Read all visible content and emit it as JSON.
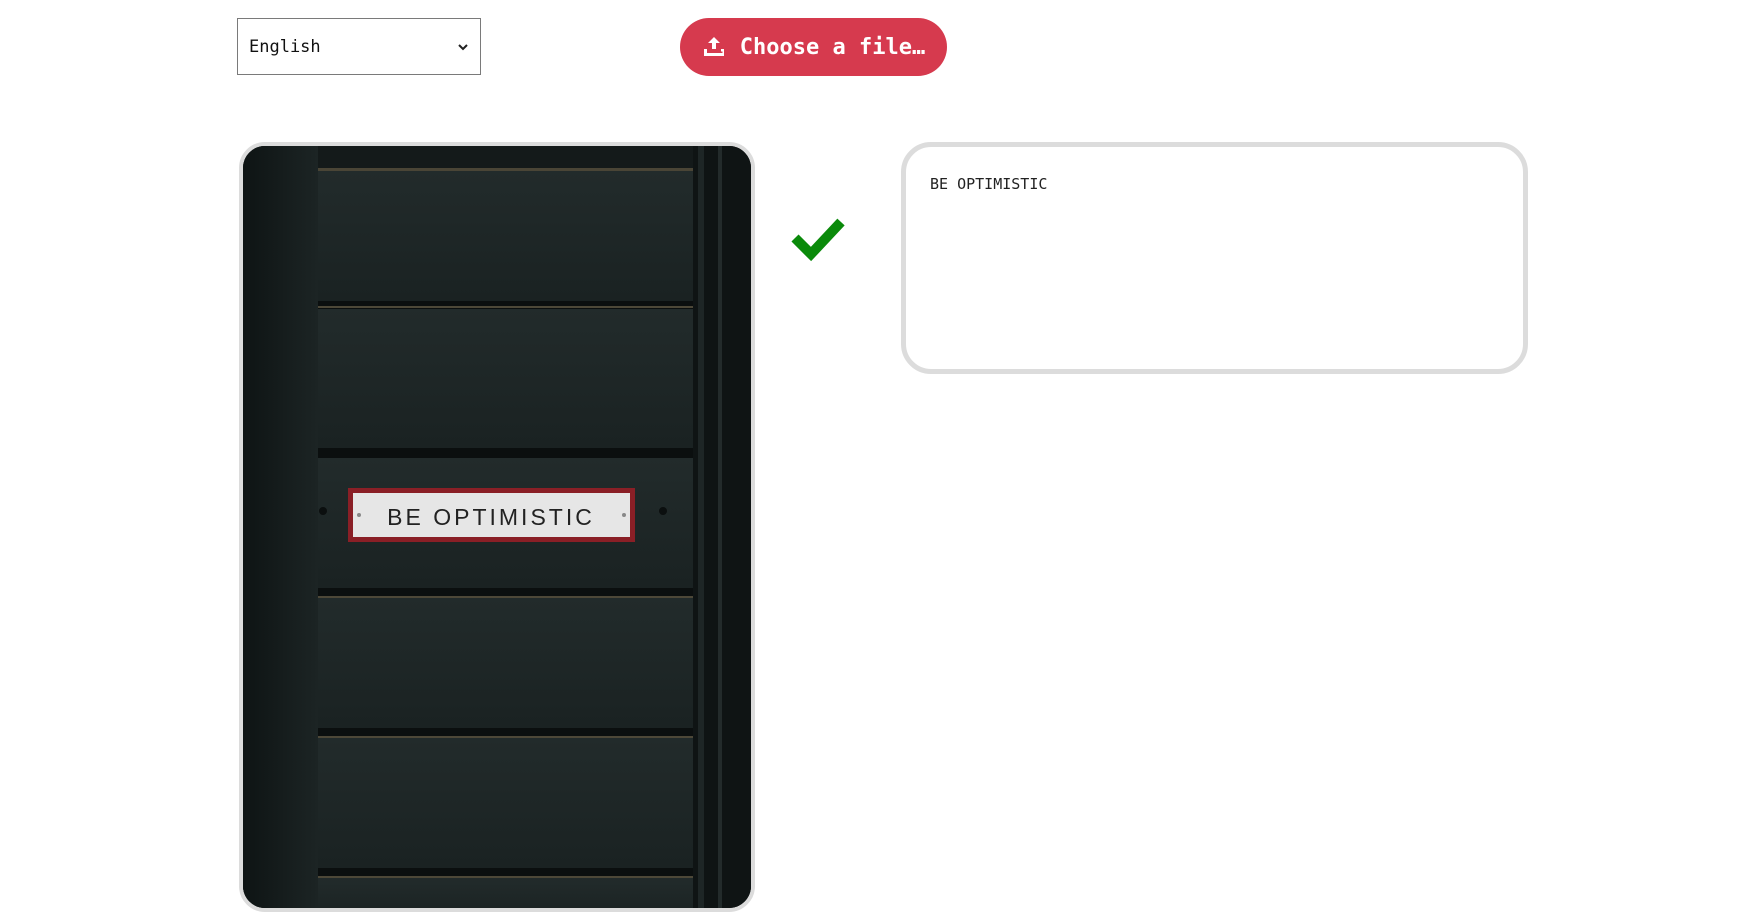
{
  "language_select": {
    "selected": "English"
  },
  "upload": {
    "label": "Choose a file…",
    "icon": "upload-icon"
  },
  "image": {
    "sign_text": "BE OPTIMISTIC"
  },
  "status": {
    "icon": "checkmark-icon",
    "color": "#0a8a0a"
  },
  "result": {
    "text": "BE OPTIMISTIC"
  },
  "colors": {
    "accent": "#d63a4e",
    "border": "#dcdcdc"
  }
}
